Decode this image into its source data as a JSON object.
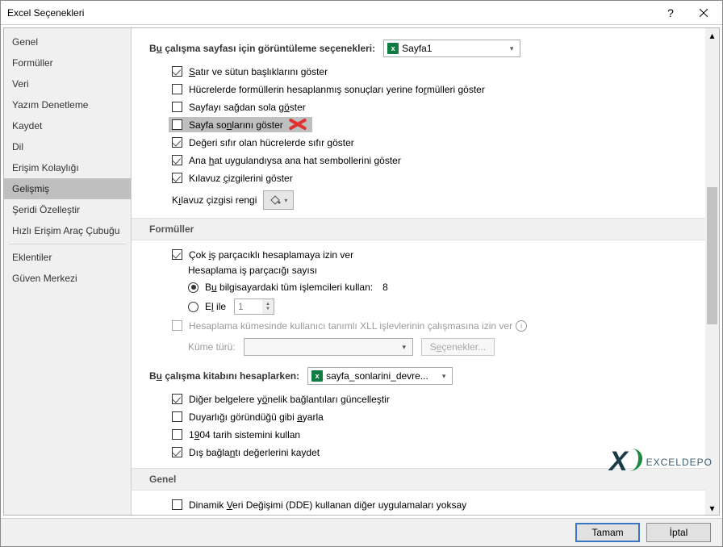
{
  "window": {
    "title": "Excel Seçenekleri",
    "help": "?"
  },
  "sidebar": {
    "items": [
      {
        "label": "Genel"
      },
      {
        "label": "Formüller"
      },
      {
        "label": "Veri"
      },
      {
        "label": "Yazım Denetleme"
      },
      {
        "label": "Kaydet"
      },
      {
        "label": "Dil"
      },
      {
        "label": "Erişim Kolaylığı"
      },
      {
        "label": "Gelişmiş"
      },
      {
        "label": "Şeridi Özelleştir"
      },
      {
        "label": "Hızlı Erişim Araç Çubuğu"
      },
      {
        "label": "Eklentiler"
      },
      {
        "label": "Güven Merkezi"
      }
    ]
  },
  "display": {
    "section_prefix": "B",
    "section_u": "u",
    "section_rest": " çalışma sayfası için görüntüleme seçenekleri:",
    "sheet": "Sayfa1",
    "c1_pre": "",
    "c1_u": "S",
    "c1_post": "atır ve sütun başlıklarını göster",
    "c2_pre": "Hücrelerde formüllerin hesaplanmış sonuçları yerine fo",
    "c2_u": "r",
    "c2_post": "mülleri göster",
    "c3_pre": "Sayfayı sağdan sola g",
    "c3_u": "ö",
    "c3_post": "ster",
    "c4_pre": "Sayfa so",
    "c4_u": "n",
    "c4_post": "larını göster",
    "c5_pre": "De",
    "c5_u": "ğ",
    "c5_post": "eri sıfır olan hücrelerde sıfır göster",
    "c6_pre": "Ana ",
    "c6_u": "h",
    "c6_post": "at uygulandıysa ana hat sembollerini göster",
    "c7_pre": "Kılavuz ",
    "c7_u": "ç",
    "c7_post": "izgilerini göster",
    "grid_label_pre": "K",
    "grid_label_u": "ı",
    "grid_label_post": "lavuz çizgisi rengi"
  },
  "formulas": {
    "header": "Formüller",
    "c1_pre": "Çok ",
    "c1_u": "i",
    "c1_post": "ş parçacıklı hesaplamaya izin ver",
    "threads_label": "Hesaplama iş parçacığı sayısı",
    "r1_pre": "B",
    "r1_u": "u",
    "r1_post": " bilgisayardaki tüm işlemcileri kullan:",
    "r1_val": "8",
    "r2_pre": "E",
    "r2_u": "l",
    "r2_post": " ile",
    "r2_spin": "1",
    "xll_label": "Hesaplama kümesinde kullanıcı tanımlı XLL işlevlerinin çalışmasına izin ver",
    "cluster_label": "Küme türü:",
    "cluster_btn_pre": "S",
    "cluster_btn_u": "e",
    "cluster_btn_post": "çenekler..."
  },
  "workbook": {
    "section_prefix": "B",
    "section_u": "u",
    "section_rest": " çalışma kitabını hesaplarken:",
    "wb": "sayfa_sonlarini_devre...",
    "c1_pre": "Diğer belgelere y",
    "c1_u": "ö",
    "c1_post": "nelik bağlantıları güncelleştir",
    "c2_pre": "Duyarlığı göründüğü gibi ",
    "c2_u": "a",
    "c2_post": "yarla",
    "c3_pre": "1",
    "c3_u": "9",
    "c3_post": "04 tarih sistemini kullan",
    "c4_pre": "Dış bağla",
    "c4_u": "n",
    "c4_post": "tı değerlerini kaydet"
  },
  "general": {
    "header": "Genel",
    "c1_pre": "Dinamik ",
    "c1_u": "V",
    "c1_post": "eri Değişimi (DDE) kullanan diğer uygulamaları yoksay"
  },
  "footer": {
    "ok": "Tamam",
    "cancel": "İptal"
  },
  "watermark": {
    "brand": "EXCELDEP",
    "last": "O"
  }
}
